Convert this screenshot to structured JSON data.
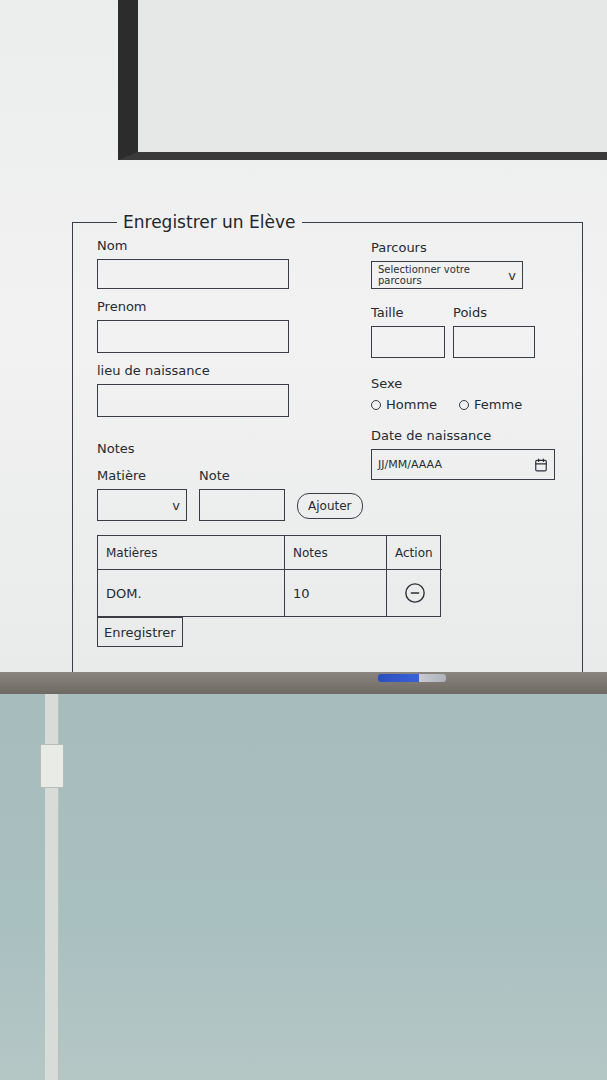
{
  "title": "Enregistrer un Elève",
  "identity_fields": [
    {
      "label": "Nom"
    },
    {
      "label": "Prenom"
    },
    {
      "label": "lieu de naissance"
    }
  ],
  "parcours": {
    "label": "Parcours",
    "placeholder": "Selectionner votre parcours",
    "chevron": "v"
  },
  "measures": [
    {
      "label": "Taille"
    },
    {
      "label": "Poids"
    }
  ],
  "sexe": {
    "label": "Sexe",
    "options": [
      {
        "label": "Homme",
        "selected": false
      },
      {
        "label": "Femme",
        "selected": false
      }
    ]
  },
  "birth_date": {
    "label": "Date de naissance",
    "placeholder": "JJ/MM/AAAA"
  },
  "notes": {
    "label": "Notes",
    "subject": {
      "label": "Matière",
      "chevron": "v"
    },
    "grade": {
      "label": "Note"
    },
    "add_button": "Ajouter"
  },
  "table": {
    "columns": [
      "Matières",
      "Notes",
      "Action"
    ],
    "rows": [
      {
        "subject": "DOM.",
        "grade": "10"
      }
    ]
  },
  "submit_button": "Enregistrer"
}
